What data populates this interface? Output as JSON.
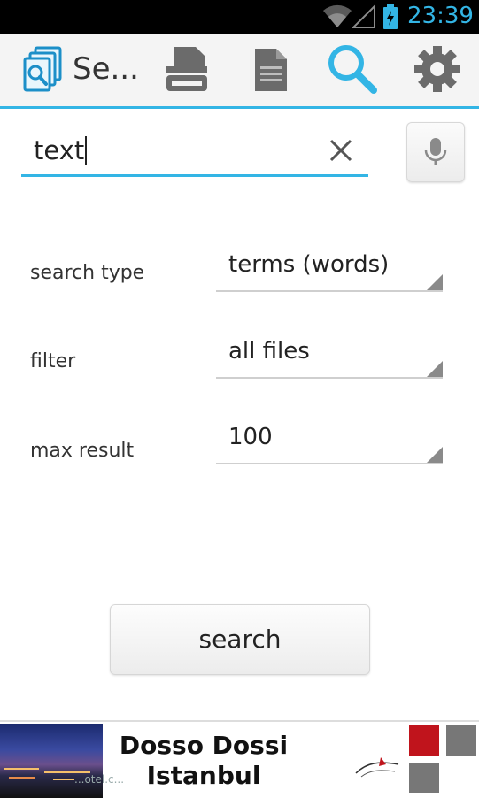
{
  "status_bar": {
    "time": "23:39"
  },
  "action_bar": {
    "title": "Se...",
    "icons": [
      "app-search-icon",
      "scanner-icon",
      "document-icon",
      "search-icon",
      "settings-icon"
    ]
  },
  "search": {
    "value": "text"
  },
  "fields": [
    {
      "label": "search type",
      "value": "terms (words)"
    },
    {
      "label": "filter",
      "value": "all files"
    },
    {
      "label": "max result",
      "value": "100"
    }
  ],
  "search_button": {
    "label": "search"
  },
  "ad": {
    "headline_line1": "Dosso Dossi",
    "headline_line2": "Istanbul",
    "sub": "...otel.c...",
    "colors": [
      "#c0141c",
      "#777777",
      "#777777"
    ]
  },
  "colors": {
    "accent": "#33b5e5",
    "statusbar": "#000000",
    "actionbar": "#f4f4f4"
  }
}
